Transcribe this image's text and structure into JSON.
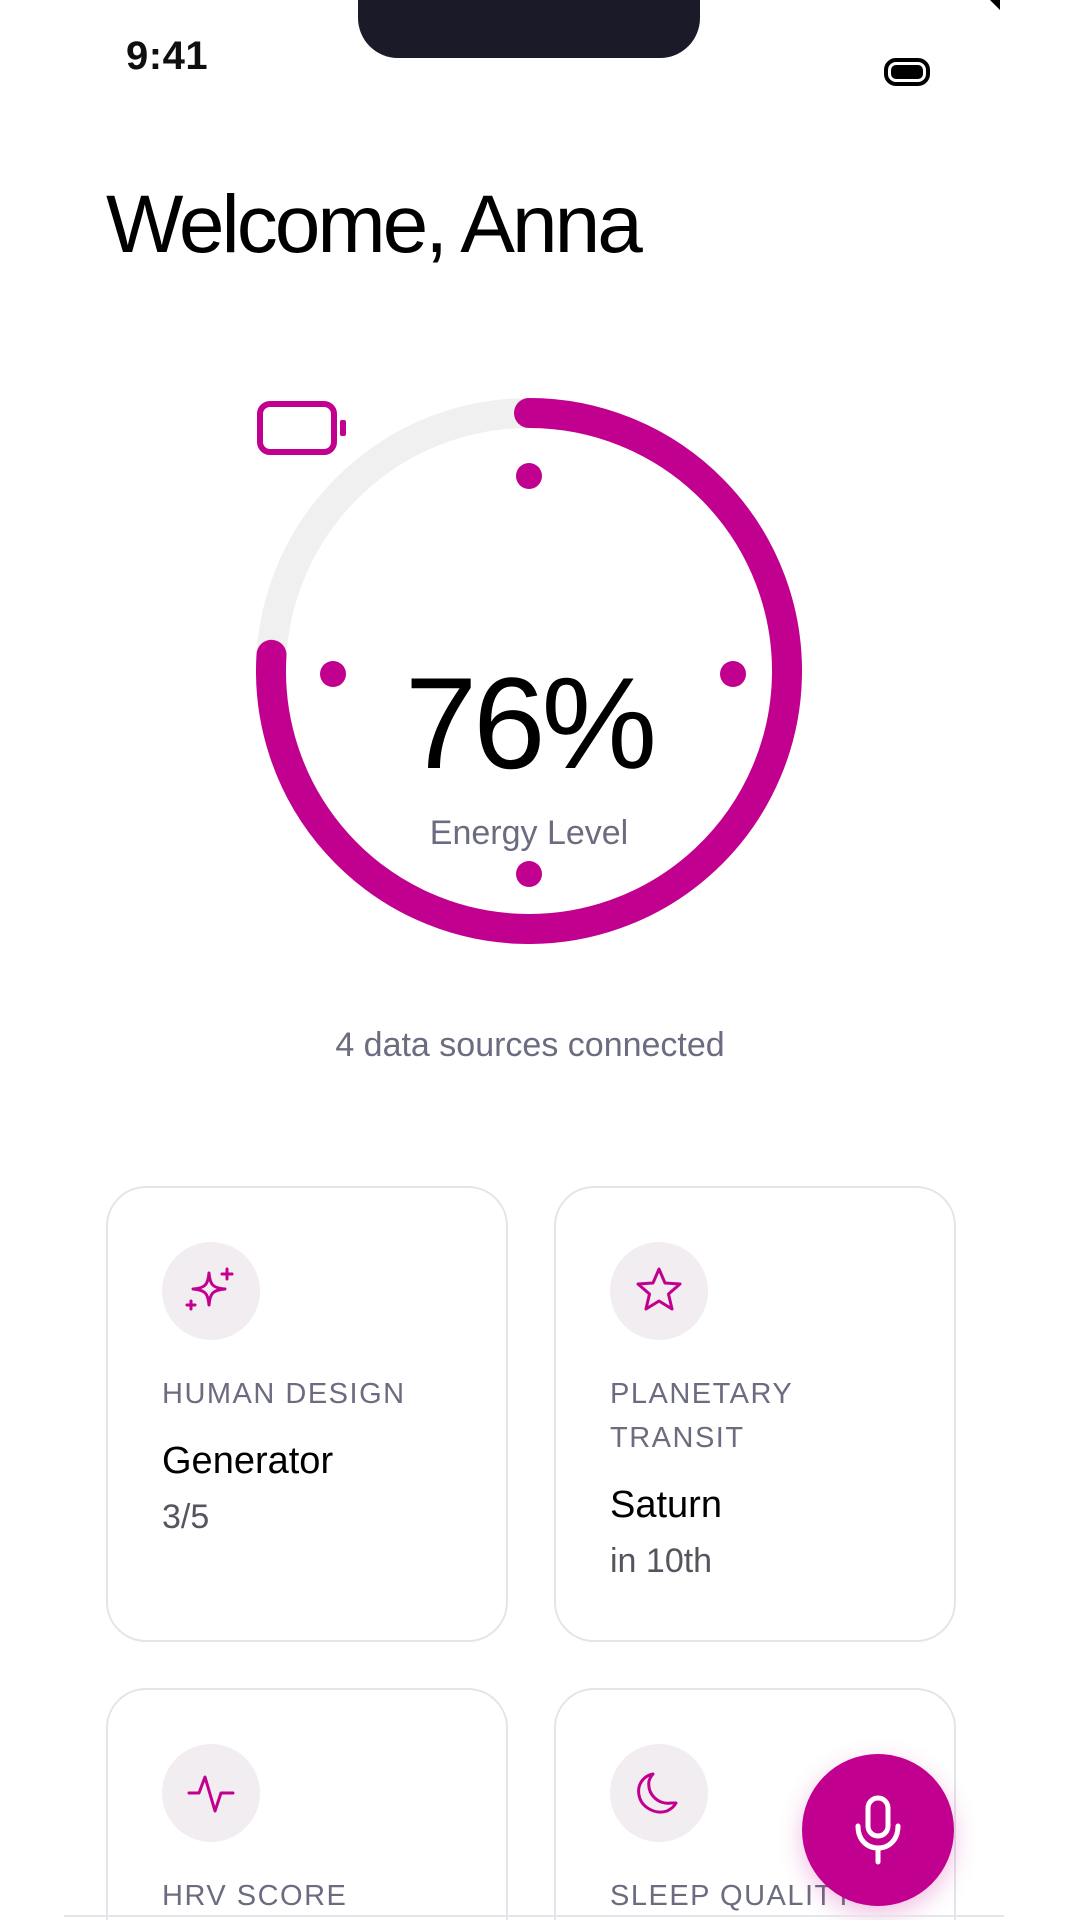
{
  "status_bar": {
    "time": "9:41"
  },
  "header": {
    "title": "Welcome, Anna"
  },
  "energy": {
    "value": 0.76,
    "value_text": "76%",
    "label": "Energy Level",
    "accent_color": "#c2008f",
    "track_color": "#f0f0f0"
  },
  "sources_text": "4 data sources connected",
  "cards": [
    {
      "icon": "sparkles-icon",
      "label_lines": [
        "HUMAN DESIGN"
      ],
      "value": "Generator",
      "sub": "3/5"
    },
    {
      "icon": "star-icon",
      "label_lines": [
        "PLANETARY",
        "TRANSIT"
      ],
      "value": "Saturn",
      "sub": "in 10th"
    },
    {
      "icon": "pulse-icon",
      "label_lines": [
        "HRV SCORE"
      ],
      "value": "",
      "sub": ""
    },
    {
      "icon": "moon-icon",
      "label_lines": [
        "SLEEP QUALITY"
      ],
      "value": "",
      "sub": ""
    }
  ],
  "fab": {
    "icon": "microphone-icon"
  }
}
